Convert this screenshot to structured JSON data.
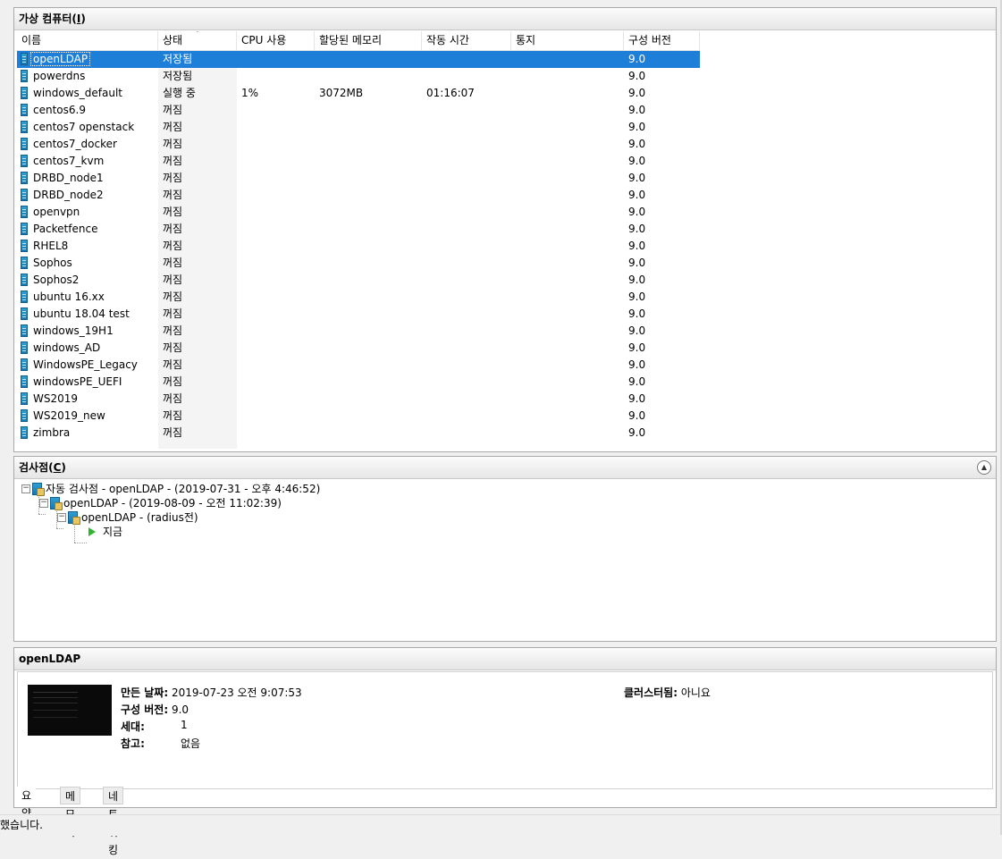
{
  "vm_panel": {
    "title": "가상 컴퓨터(",
    "title_key": "I",
    "title_end": ")",
    "columns": {
      "name": "이름",
      "status": "상태",
      "cpu": "CPU 사용",
      "memory": "할당된 메모리",
      "uptime": "작동 시간",
      "notes": "통지",
      "version": "구성 버전"
    },
    "rows": [
      {
        "name": "openLDAP",
        "status": "저장됨",
        "cpu": "",
        "memory": "",
        "uptime": "",
        "version": "9.0"
      },
      {
        "name": "powerdns",
        "status": "저장됨",
        "cpu": "",
        "memory": "",
        "uptime": "",
        "version": "9.0"
      },
      {
        "name": "windows_default",
        "status": "실행 중",
        "cpu": "1%",
        "memory": "3072MB",
        "uptime": "01:16:07",
        "version": "9.0"
      },
      {
        "name": "centos6.9",
        "status": "꺼짐",
        "cpu": "",
        "memory": "",
        "uptime": "",
        "version": "9.0"
      },
      {
        "name": "centos7 openstack",
        "status": "꺼짐",
        "cpu": "",
        "memory": "",
        "uptime": "",
        "version": "9.0"
      },
      {
        "name": "centos7_docker",
        "status": "꺼짐",
        "cpu": "",
        "memory": "",
        "uptime": "",
        "version": "9.0"
      },
      {
        "name": "centos7_kvm",
        "status": "꺼짐",
        "cpu": "",
        "memory": "",
        "uptime": "",
        "version": "9.0"
      },
      {
        "name": "DRBD_node1",
        "status": "꺼짐",
        "cpu": "",
        "memory": "",
        "uptime": "",
        "version": "9.0"
      },
      {
        "name": "DRBD_node2",
        "status": "꺼짐",
        "cpu": "",
        "memory": "",
        "uptime": "",
        "version": "9.0"
      },
      {
        "name": "openvpn",
        "status": "꺼짐",
        "cpu": "",
        "memory": "",
        "uptime": "",
        "version": "9.0"
      },
      {
        "name": "Packetfence",
        "status": "꺼짐",
        "cpu": "",
        "memory": "",
        "uptime": "",
        "version": "9.0"
      },
      {
        "name": "RHEL8",
        "status": "꺼짐",
        "cpu": "",
        "memory": "",
        "uptime": "",
        "version": "9.0"
      },
      {
        "name": "Sophos",
        "status": "꺼짐",
        "cpu": "",
        "memory": "",
        "uptime": "",
        "version": "9.0"
      },
      {
        "name": "Sophos2",
        "status": "꺼짐",
        "cpu": "",
        "memory": "",
        "uptime": "",
        "version": "9.0"
      },
      {
        "name": "ubuntu 16.xx",
        "status": "꺼짐",
        "cpu": "",
        "memory": "",
        "uptime": "",
        "version": "9.0"
      },
      {
        "name": "ubuntu 18.04 test",
        "status": "꺼짐",
        "cpu": "",
        "memory": "",
        "uptime": "",
        "version": "9.0"
      },
      {
        "name": "windows_19H1",
        "status": "꺼짐",
        "cpu": "",
        "memory": "",
        "uptime": "",
        "version": "9.0"
      },
      {
        "name": "windows_AD",
        "status": "꺼짐",
        "cpu": "",
        "memory": "",
        "uptime": "",
        "version": "9.0"
      },
      {
        "name": "WindowsPE_Legacy",
        "status": "꺼짐",
        "cpu": "",
        "memory": "",
        "uptime": "",
        "version": "9.0"
      },
      {
        "name": "windowsPE_UEFI",
        "status": "꺼짐",
        "cpu": "",
        "memory": "",
        "uptime": "",
        "version": "9.0"
      },
      {
        "name": "WS2019",
        "status": "꺼짐",
        "cpu": "",
        "memory": "",
        "uptime": "",
        "version": "9.0"
      },
      {
        "name": "WS2019_new",
        "status": "꺼짐",
        "cpu": "",
        "memory": "",
        "uptime": "",
        "version": "9.0"
      },
      {
        "name": "zimbra",
        "status": "꺼짐",
        "cpu": "",
        "memory": "",
        "uptime": "",
        "version": "9.0"
      }
    ],
    "selected_index": 0
  },
  "checkpoint_panel": {
    "title": "검사점(",
    "title_key": "C",
    "title_end": ")",
    "nodes": [
      {
        "label": "자동 검사점 - openLDAP - (2019-07-31 - 오후 4:46:52)"
      },
      {
        "label": "openLDAP - (2019-08-09 - 오전 11:02:39)"
      },
      {
        "label": "openLDAP - (radius전)"
      },
      {
        "label": "지금"
      }
    ]
  },
  "detail_panel": {
    "title": "openLDAP",
    "props": {
      "created_label": "만든 날짜:",
      "created_value": "2019-07-23 오전 9:07:53",
      "version_label": "구성 버전:",
      "version_value": "9.0",
      "generation_label": "세대:",
      "generation_value": "1",
      "notes_label": "참고:",
      "notes_value": "없음",
      "clustered_label": "클러스터됨:",
      "clustered_value": "아니요"
    },
    "tabs": [
      "요약",
      "메모리",
      "네트워킹"
    ]
  },
  "status_bar": {
    "text": "했습니다."
  }
}
